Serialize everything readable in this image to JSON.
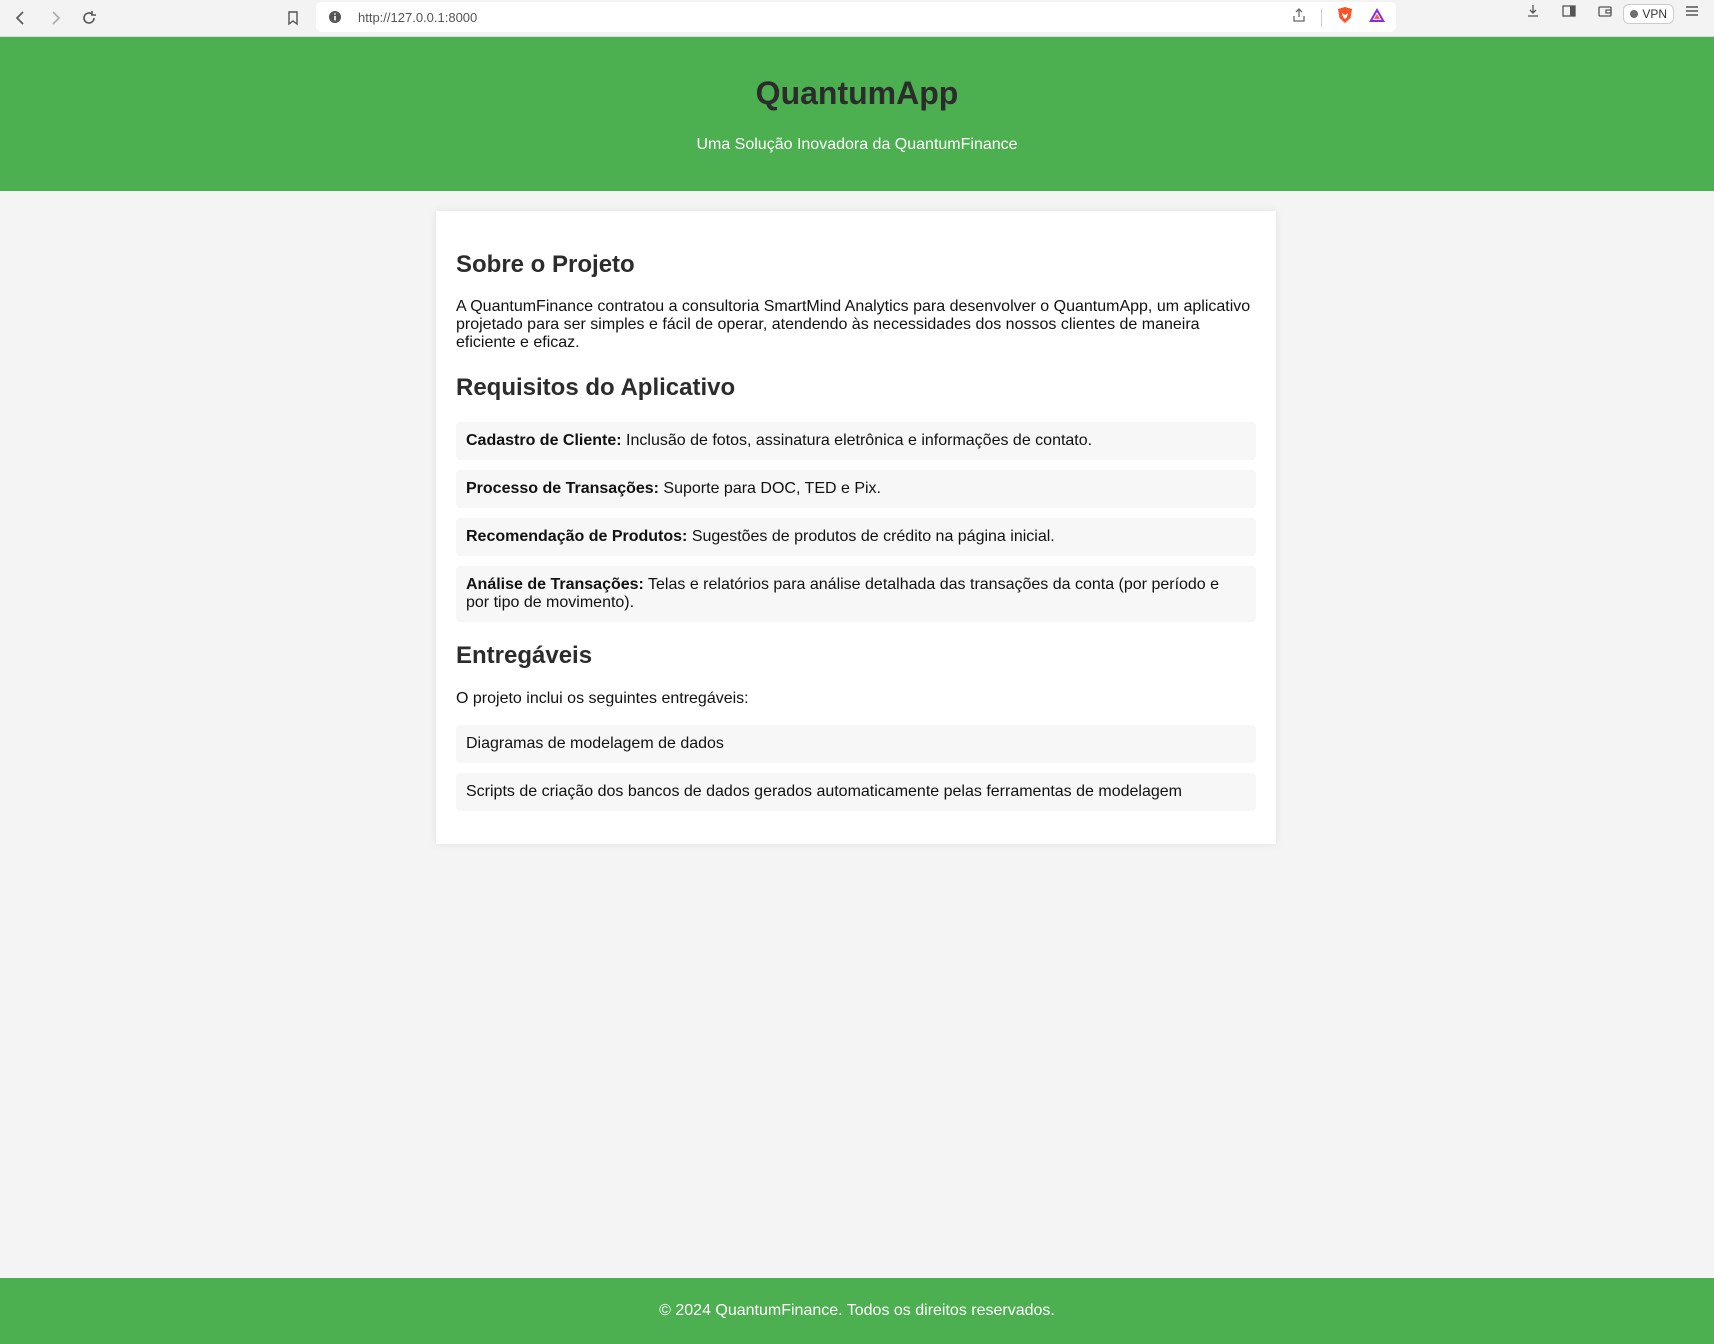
{
  "browser": {
    "url": "http://127.0.0.1:8000",
    "vpn_label": "VPN"
  },
  "header": {
    "title": "QuantumApp",
    "subtitle": "Uma Solução Inovadora da QuantumFinance"
  },
  "about": {
    "heading": "Sobre o Projeto",
    "text": "A QuantumFinance contratou a consultoria SmartMind Analytics para desenvolver o QuantumApp, um aplicativo projetado para ser simples e fácil de operar, atendendo às necessidades dos nossos clientes de maneira eficiente e eficaz."
  },
  "requirements": {
    "heading": "Requisitos do Aplicativo",
    "items": [
      {
        "label": "Cadastro de Cliente:",
        "text": " Inclusão de fotos, assinatura eletrônica e informações de contato."
      },
      {
        "label": "Processo de Transações:",
        "text": " Suporte para DOC, TED e Pix."
      },
      {
        "label": "Recomendação de Produtos:",
        "text": " Sugestões de produtos de crédito na página inicial."
      },
      {
        "label": "Análise de Transações:",
        "text": " Telas e relatórios para análise detalhada das transações da conta (por período e por tipo de movimento)."
      }
    ]
  },
  "deliverables": {
    "heading": "Entregáveis",
    "intro": "O projeto inclui os seguintes entregáveis:",
    "items": [
      "Diagramas de modelagem de dados",
      "Scripts de criação dos bancos de dados gerados automaticamente pelas ferramentas de modelagem"
    ]
  },
  "footer": {
    "text": "© 2024 QuantumFinance. Todos os direitos reservados."
  },
  "colors": {
    "brand_green": "#4caf50",
    "page_bg": "#f4f4f4"
  }
}
